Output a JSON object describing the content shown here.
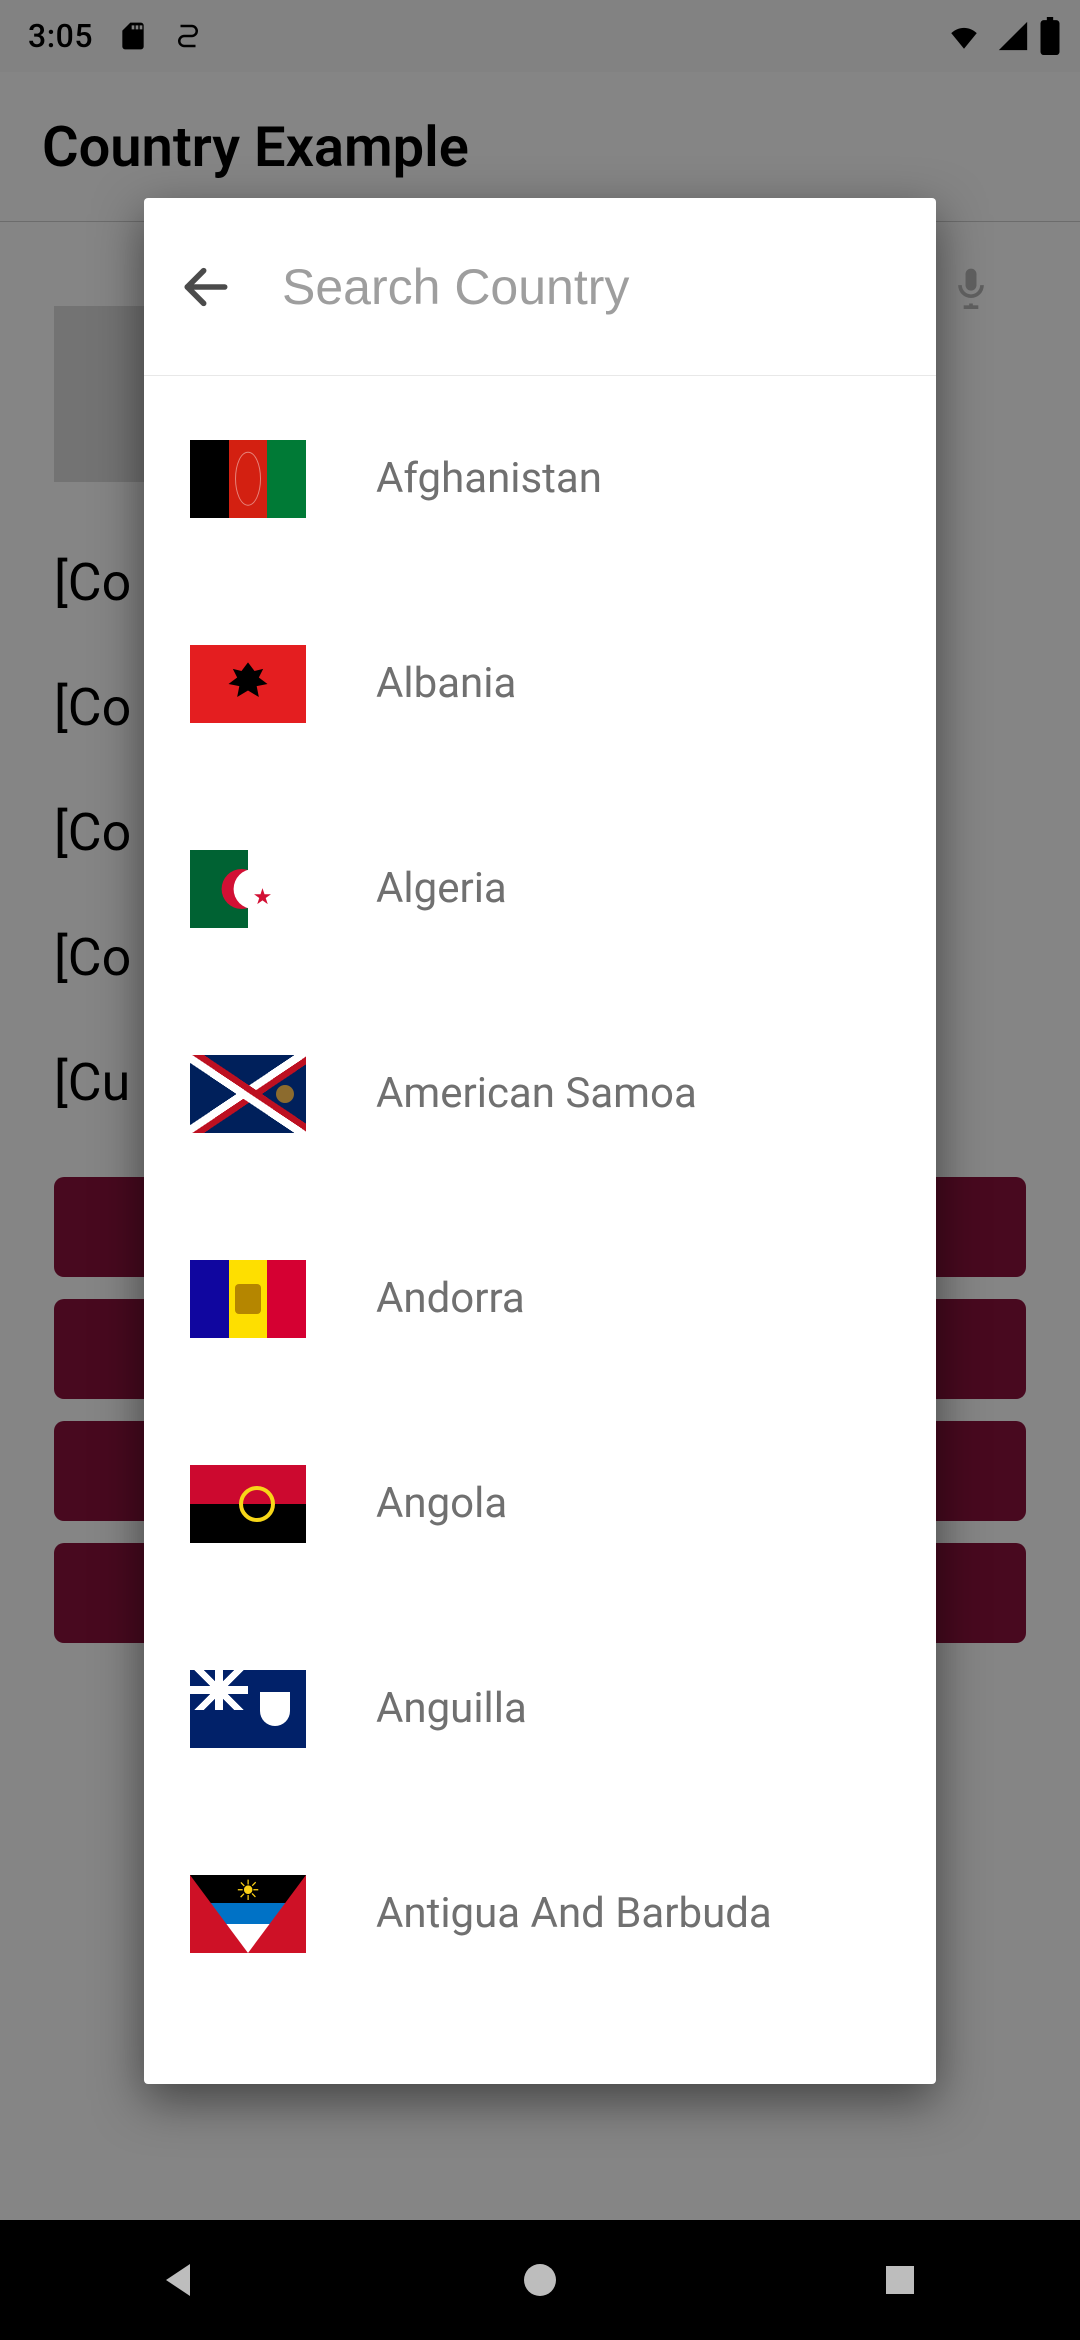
{
  "statusbar": {
    "clock": "3:05"
  },
  "appbar": {
    "title": "Country Example"
  },
  "page": {
    "fields": [
      "[Co",
      "[Co",
      "[Co",
      "[Co",
      "[Cu"
    ]
  },
  "dialog": {
    "search_placeholder": "Search Country",
    "countries": [
      {
        "name": "Afghanistan",
        "flag": "af"
      },
      {
        "name": "Albania",
        "flag": "al"
      },
      {
        "name": "Algeria",
        "flag": "dz"
      },
      {
        "name": "American Samoa",
        "flag": "as"
      },
      {
        "name": "Andorra",
        "flag": "ad"
      },
      {
        "name": "Angola",
        "flag": "ao"
      },
      {
        "name": "Anguilla",
        "flag": "ai"
      },
      {
        "name": "Antigua And Barbuda",
        "flag": "ag"
      }
    ]
  },
  "colors": {
    "accent": "#8a123d"
  }
}
